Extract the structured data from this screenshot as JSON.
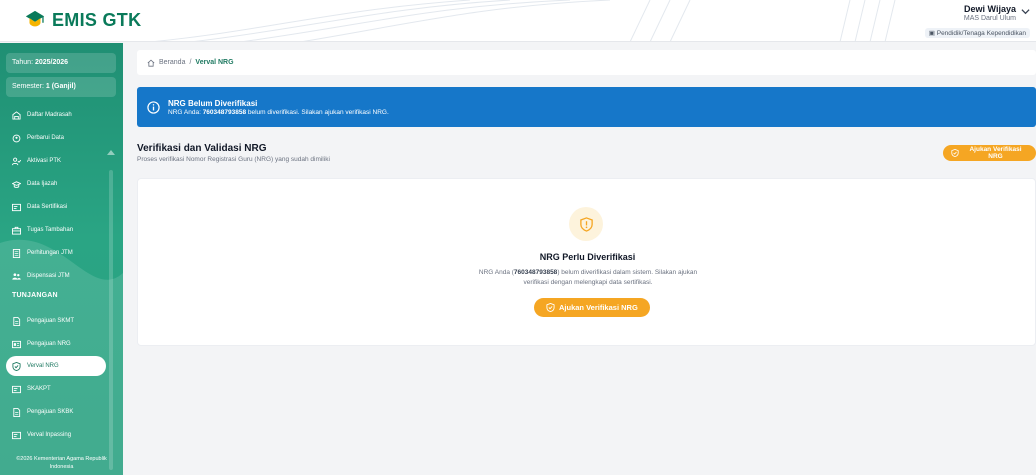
{
  "app": {
    "logo_text": "EMIS GTK"
  },
  "user": {
    "name": "Dewi Wijaya",
    "school": "MAS Darul Ulum",
    "role": "Pendidik/Tenaga Kependidikan"
  },
  "sidebar": {
    "year_label": "Tahun:",
    "year_value": "2025/2026",
    "semester_label": "Semester:",
    "semester_value": "1 (Ganjil)",
    "items": [
      {
        "label": "Daftar Madrasah",
        "icon": "building-icon"
      },
      {
        "label": "Perbarui Data",
        "icon": "refresh-user-icon"
      },
      {
        "label": "Aktivasi PTK",
        "icon": "user-check-icon"
      },
      {
        "label": "Data Ijazah",
        "icon": "graduation-cap-icon"
      },
      {
        "label": "Data Sertifikasi",
        "icon": "certificate-icon"
      },
      {
        "label": "Tugas Tambahan",
        "icon": "briefcase-icon"
      },
      {
        "label": "Perhitungan JTM",
        "icon": "calculator-icon"
      },
      {
        "label": "Dispensasi JTM",
        "icon": "users-icon"
      }
    ],
    "section_tunjangan": "TUNJANGAN",
    "items2": [
      {
        "label": "Pengajuan SKMT",
        "icon": "document-icon"
      },
      {
        "label": "Pengajuan NRG",
        "icon": "id-card-icon"
      },
      {
        "label": "Verval NRG",
        "icon": "shield-check-icon",
        "active": true
      },
      {
        "label": "SKAKPT",
        "icon": "certificate-icon"
      },
      {
        "label": "Pengajuan SKBK",
        "icon": "document-icon"
      },
      {
        "label": "Verval Inpassing",
        "icon": "certificate-icon"
      }
    ],
    "footer": "©2026 Kementerian Agama Republik Indonesia"
  },
  "breadcrumb": {
    "home": "Beranda",
    "separator": "/",
    "current": "Verval NRG"
  },
  "alert": {
    "title": "NRG Belum Diverifikasi",
    "msg_prefix": "NRG Anda: ",
    "nrg": "760348793858",
    "msg_suffix": " belum diverifikasi. Silakan ajukan verifikasi NRG."
  },
  "section": {
    "title": "Verifikasi dan Validasi NRG",
    "subtitle": "Proses verifikasi Nomor Registrasi Guru (NRG) yang sudah dimiliki",
    "button": "Ajukan Verifikasi NRG"
  },
  "empty": {
    "title": "NRG Perlu Diverifikasi",
    "desc_prefix": "NRG Anda (",
    "nrg": "760348793858",
    "desc_suffix": ") belum diverifikasi dalam sistem. Silakan ajukan verifikasi dengan melengkapi data sertifikasi.",
    "button": "Ajukan Verifikasi NRG"
  },
  "colors": {
    "brand": "#1f8f73",
    "alert": "#1677c9",
    "accent": "#f5a623"
  }
}
